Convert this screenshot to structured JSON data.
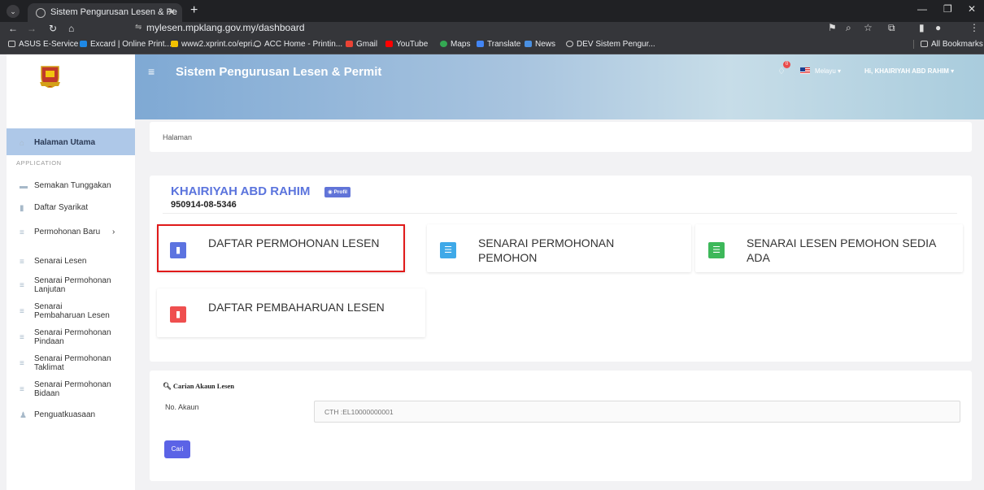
{
  "browser": {
    "tab_title": "Sistem Pengurusan Lesen & Pe",
    "url": "mylesen.mpklang.gov.my/dashboard",
    "bookmarks": [
      "ASUS E-Service",
      "Excard | Online Print...",
      "www2.xprint.co/epri...",
      "ACC Home - Printin...",
      "Gmail",
      "YouTube",
      "Maps",
      "Translate",
      "News",
      "DEV Sistem Pengur..."
    ],
    "all_bookmarks": "All Bookmarks"
  },
  "header": {
    "title": "Sistem Pengurusan Lesen & Permit",
    "notification_count": "0",
    "language": "Melayu",
    "user_greeting": "Hi, KHAIRIYAH ABD RAHIM"
  },
  "sidebar": {
    "active": "Halaman Utama",
    "caption": "APPLICATION",
    "items": [
      "Semakan Tunggakan",
      "Daftar Syarikat",
      "Permohonan Baru",
      "Senarai Lesen",
      "Senarai Permohonan Lanjutan",
      "Senarai Pembaharuan Lesen",
      "Senarai Permohonan Pindaan",
      "Senarai Permohonan Taklimat",
      "Senarai Permohonan Bidaan",
      "Penguatkuasaan"
    ]
  },
  "breadcrumb": "Halaman",
  "profile": {
    "name": "KHAIRIYAH ABD RAHIM",
    "button": "Profil",
    "ic": "950914-08-5346"
  },
  "tiles": [
    {
      "label": "DAFTAR PERMOHONAN LESEN",
      "color": "#5c73e0",
      "icon": "document-icon"
    },
    {
      "label": "SENARAI PERMOHONAN PEMOHON",
      "color": "#3fa9e8",
      "icon": "list-icon"
    },
    {
      "label": "SENARAI LESEN PEMOHON SEDIA ADA",
      "color": "#3db85a",
      "icon": "list-icon"
    },
    {
      "label": "DAFTAR PEMBAHARUAN LESEN",
      "color": "#ef4f4f",
      "icon": "document-icon"
    }
  ],
  "search": {
    "title": "Carian Akaun Lesen",
    "label": "No. Akaun",
    "placeholder": "CTH :EL10000000001",
    "button": "Cari"
  }
}
